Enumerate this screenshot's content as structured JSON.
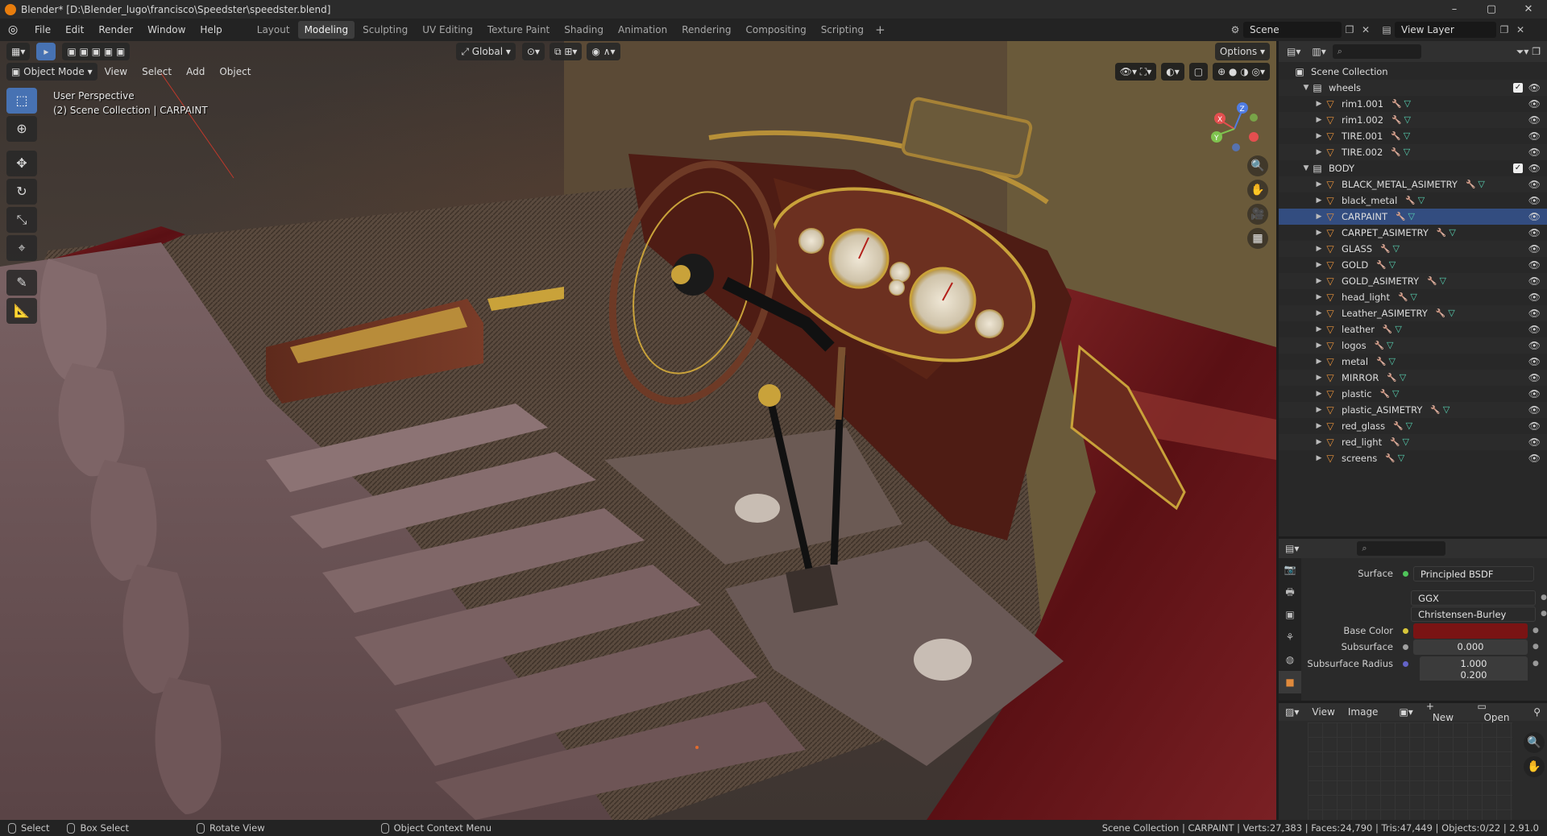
{
  "window": {
    "title": "Blender* [D:\\Blender_lugo\\francisco\\Speedster\\speedster.blend]",
    "controls": [
      "–",
      "▢",
      "✕"
    ]
  },
  "topbar": {
    "menus": [
      "File",
      "Edit",
      "Render",
      "Window",
      "Help"
    ],
    "workspaces": [
      "Layout",
      "Modeling",
      "Sculpting",
      "UV Editing",
      "Texture Paint",
      "Shading",
      "Animation",
      "Rendering",
      "Compositing",
      "Scripting"
    ],
    "active_workspace": "Modeling",
    "scene": "Scene",
    "view_layer": "View Layer"
  },
  "viewport": {
    "transform_orientation": "Global",
    "options_label": "Options",
    "mode": "Object Mode",
    "menus": [
      "View",
      "Select",
      "Add",
      "Object"
    ],
    "info_line1": "User Perspective",
    "info_line2": "(2) Scene Collection | CARPAINT",
    "gizmo_axes": {
      "x": "X",
      "y": "Y",
      "z": "Z"
    }
  },
  "outliner": {
    "root": "Scene Collection",
    "collections": [
      {
        "name": "wheels",
        "objects": [
          "rim1.001",
          "rim1.002",
          "TIRE.001",
          "TIRE.002"
        ]
      },
      {
        "name": "BODY",
        "objects": [
          "BLACK_METAL_ASIMETRY",
          "black_metal",
          "CARPAINT",
          "CARPET_ASIMETRY",
          "GLASS",
          "GOLD",
          "GOLD_ASIMETRY",
          "head_light",
          "Leather_ASIMETRY",
          "leather",
          "logos",
          "metal",
          "MIRROR",
          "plastic",
          "plastic_ASIMETRY",
          "red_glass",
          "red_light",
          "screens"
        ]
      }
    ],
    "selected": "CARPAINT"
  },
  "properties": {
    "surface_label": "Surface",
    "surface_value": "Principled BSDF",
    "distribution": "GGX",
    "subsurface_method": "Christensen-Burley",
    "base_color_label": "Base Color",
    "base_color": "#7a1414",
    "subsurface_label": "Subsurface",
    "subsurface_value": "0.000",
    "subsurface_radius_label": "Subsurface Radius",
    "subsurface_radius_value": "1.000",
    "subsurface_radius_value2": "0.200"
  },
  "image_editor": {
    "menus": [
      "View",
      "Image"
    ],
    "new_label": "New",
    "open_label": "Open"
  },
  "statusbar": {
    "select": "Select",
    "box_select": "Box Select",
    "rotate_view": "Rotate View",
    "context_menu": "Object Context Menu",
    "stats": "Scene Collection | CARPAINT | Verts:27,383 | Faces:24,790 | Tris:47,449 | Objects:0/22 | 2.91.0"
  },
  "colors": {
    "accent": "#4772b3",
    "selected_row": "#334d80",
    "carpaint": "#6e1418",
    "gold": "#c9a23a",
    "leather": "#6b5456"
  }
}
